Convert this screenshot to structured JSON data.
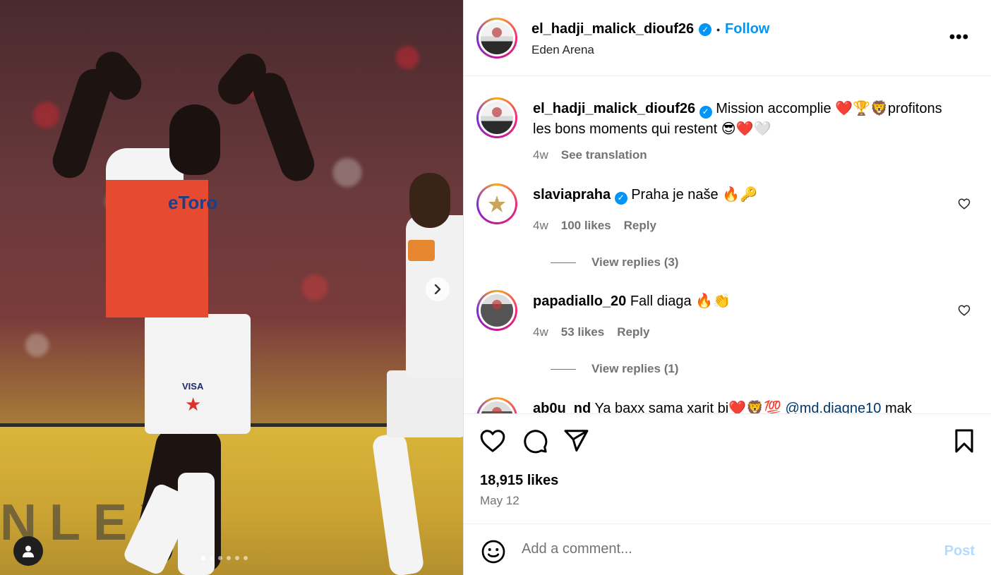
{
  "media": {
    "etoro": "eToro",
    "sponsor": "VISA",
    "board_text": "NLEY",
    "carousel_count": 6,
    "carousel_active": 1
  },
  "post": {
    "username": "el_hadji_malick_diouf26",
    "location": "Eden Arena",
    "follow_label": "Follow",
    "separator": "•",
    "more_icon": "•••",
    "caption": "Mission accomplie ❤️🏆🦁profitons les bons moments qui restent 😎❤️🤍",
    "caption_time": "4w",
    "see_translation": "See translation"
  },
  "comments": [
    {
      "username": "slaviapraha",
      "verified": true,
      "text": "Praha je naše 🔥🔑",
      "time": "4w",
      "likes": "100 likes",
      "reply": "Reply",
      "view_replies": "View replies (3)"
    },
    {
      "username": "papadiallo_20",
      "verified": false,
      "text": "Fall diaga 🔥👏",
      "time": "4w",
      "likes": "53 likes",
      "reply": "Reply",
      "view_replies": "View replies (1)"
    },
    {
      "username": "ab0u_nd",
      "text": "Ya baxx sama xarit bi❤️🦁💯",
      "mention": "@md.diagne10",
      "text_after": "mak"
    }
  ],
  "footer": {
    "likes": "18,915 likes",
    "date": "May 12",
    "comment_placeholder": "Add a comment...",
    "post_label": "Post"
  },
  "colors": {
    "accent": "#0095f6",
    "post_disabled": "#b3dbff",
    "muted": "#737373"
  }
}
